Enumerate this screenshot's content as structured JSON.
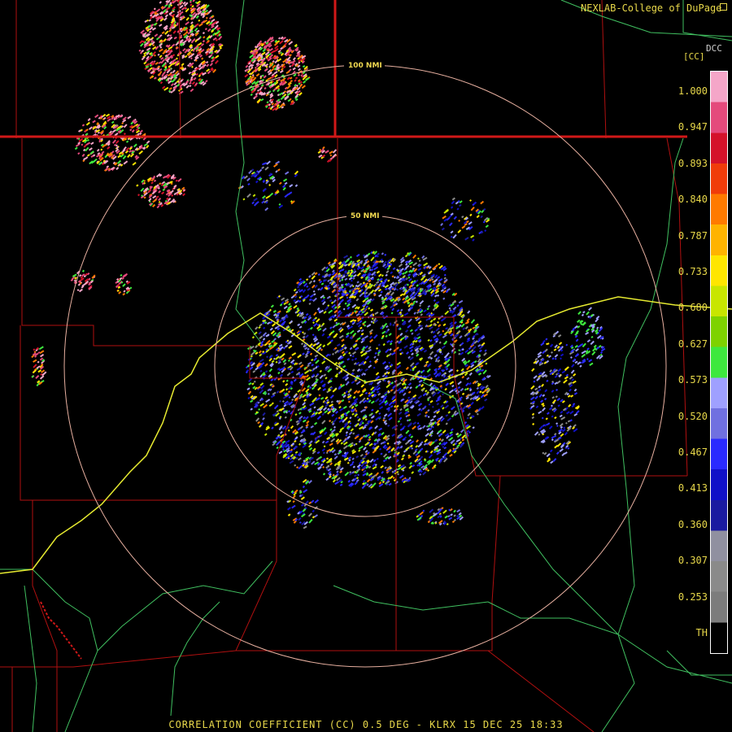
{
  "credit": "NEXLAB-College of DuPage",
  "credit_icon": "resize-corner-icon",
  "site_tag": "DCC",
  "colorbar": {
    "unit_label": "[CC]",
    "ticks": [
      "1.000",
      "0.947",
      "0.893",
      "0.840",
      "0.787",
      "0.733",
      "0.680",
      "0.627",
      "0.573",
      "0.520",
      "0.467",
      "0.413",
      "0.360",
      "0.307",
      "0.253",
      "TH"
    ],
    "colors": [
      "#f4a6c8",
      "#e44a7c",
      "#d4122a",
      "#f03c0a",
      "#ff7a00",
      "#ffb300",
      "#ffe600",
      "#c8e600",
      "#7ed200",
      "#3ee83e",
      "#9fa0ff",
      "#7070e0",
      "#2a2aff",
      "#1010c8",
      "#1a1aa0",
      "#9090a0",
      "#8a8a8a",
      "#7c7c7c",
      "#000000"
    ]
  },
  "range_rings": [
    {
      "label": "50 NMI"
    },
    {
      "label": "100 NMI"
    }
  ],
  "caption": "CORRELATION COEFFICIENT (CC) 0.5 DEG - KLRX 15 DEC 25 18:33",
  "colors": {
    "state_border": "#d01818",
    "county_line": "#b01010",
    "highway": "#40c060",
    "interstate": "#e6ea30",
    "ring": "#e8b0a0",
    "text": "#e8d84a"
  }
}
